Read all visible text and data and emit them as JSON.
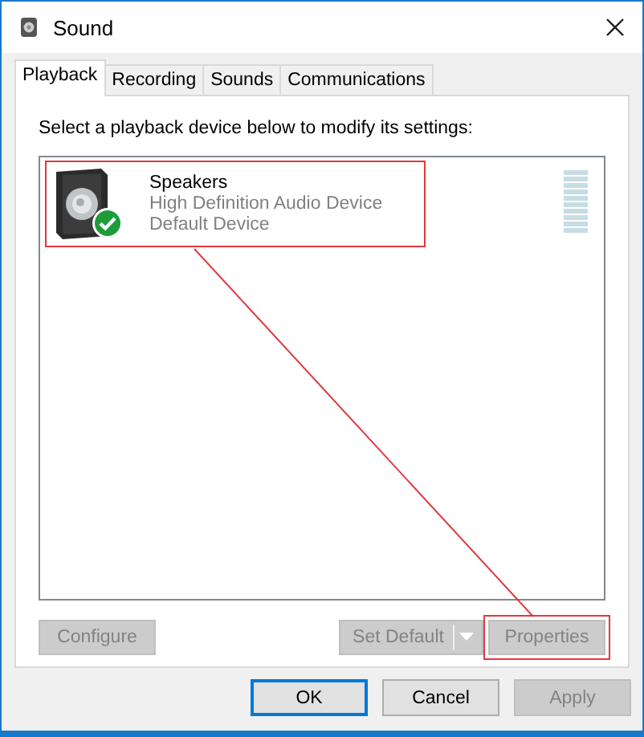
{
  "window": {
    "title": "Sound"
  },
  "tabs": [
    {
      "label": "Playback",
      "selected": true
    },
    {
      "label": "Recording",
      "selected": false
    },
    {
      "label": "Sounds",
      "selected": false
    },
    {
      "label": "Communications",
      "selected": false
    }
  ],
  "instruction": "Select a playback device below to modify its settings:",
  "devices": [
    {
      "name": "Speakers",
      "driver": "High Definition Audio Device",
      "status": "Default Device",
      "is_default": true,
      "highlighted": true
    }
  ],
  "device_buttons": [
    {
      "kind": "plain",
      "label": "Configure",
      "disabled": true,
      "highlighted": false
    },
    {
      "kind": "split",
      "label": "Set Default",
      "disabled": true,
      "highlighted": false
    },
    {
      "kind": "plain",
      "label": "Properties",
      "disabled": true,
      "highlighted": true
    }
  ],
  "dialog_buttons": [
    {
      "label": "OK",
      "disabled": false,
      "focused": true
    },
    {
      "label": "Cancel",
      "disabled": false,
      "focused": false
    },
    {
      "label": "Apply",
      "disabled": true,
      "focused": false
    }
  ]
}
